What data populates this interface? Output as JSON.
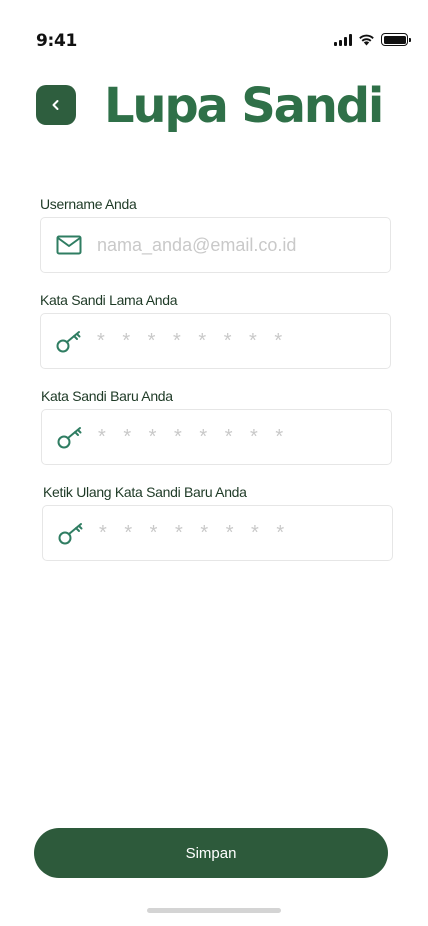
{
  "status_bar": {
    "time": "9:41"
  },
  "header": {
    "title": "Lupa Sandi",
    "back_icon": "chevron-left-icon"
  },
  "form": {
    "fields": [
      {
        "label": "Username Anda",
        "placeholder": "nama_anda@email.co.id",
        "icon": "mail-icon",
        "value": ""
      },
      {
        "label": "Kata Sandi Lama Anda",
        "placeholder": "* * * * * * * *",
        "icon": "key-icon",
        "value": ""
      },
      {
        "label": "Kata Sandi Baru Anda",
        "placeholder": "* * * * * * * *",
        "icon": "key-icon",
        "value": ""
      },
      {
        "label": "Ketik Ulang Kata Sandi Baru Anda",
        "placeholder": "* * * * * * * *",
        "icon": "key-icon",
        "value": ""
      }
    ],
    "submit_label": "Simpan"
  },
  "colors": {
    "primary": "#2d5a3b",
    "title": "#2f7048",
    "icon": "#2f7d62",
    "placeholder": "#c9c9c9"
  }
}
